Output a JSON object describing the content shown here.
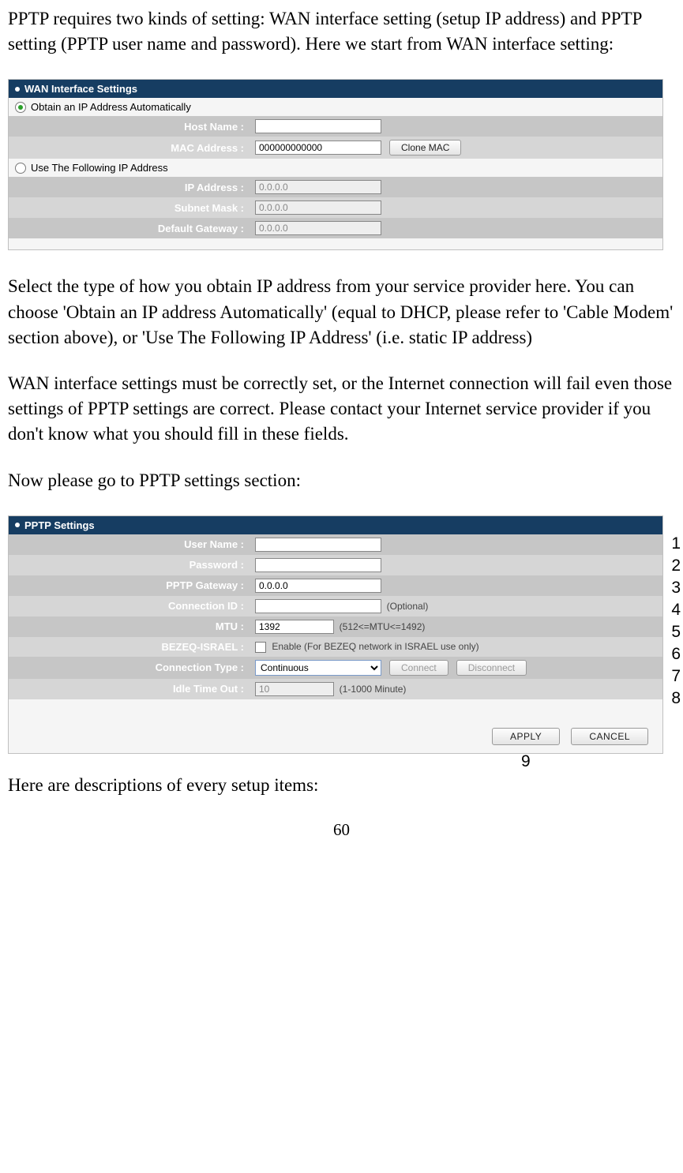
{
  "paragraphs": {
    "p1": "PPTP requires two kinds of setting: WAN interface setting (setup IP address) and PPTP setting (PPTP user name and password). Here we start from WAN interface setting:",
    "p2": "Select the type of how you obtain IP address from your service provider here. You can choose 'Obtain an IP address Automatically' (equal to DHCP, please refer to 'Cable Modem' section above), or 'Use The Following IP Address' (i.e. static IP address)",
    "p3": "WAN interface settings must be correctly set, or the Internet connection will fail even those settings of PPTP settings are correct. Please contact your Internet service provider if you don't know what you should fill in these fields.",
    "p4": "Now please go to PPTP settings section:",
    "p5": "Here are descriptions of every setup items:"
  },
  "page_number": "60",
  "wan": {
    "title": "WAN Interface Settings",
    "radio_auto": "Obtain an IP Address Automatically",
    "radio_static": "Use The Following IP Address",
    "host_name_label": "Host Name :",
    "host_name_value": "",
    "mac_label": "MAC Address :",
    "mac_value": "000000000000",
    "clone_mac": "Clone MAC",
    "ip_label": "IP Address :",
    "ip_value": "0.0.0.0",
    "subnet_label": "Subnet Mask :",
    "subnet_value": "0.0.0.0",
    "gateway_label": "Default Gateway :",
    "gateway_value": "0.0.0.0"
  },
  "pptp": {
    "title": "PPTP Settings",
    "user_label": "User Name :",
    "user_value": "",
    "pass_label": "Password :",
    "pass_value": "",
    "gw_label": "PPTP Gateway :",
    "gw_value": "0.0.0.0",
    "connid_label": "Connection ID :",
    "connid_value": "",
    "connid_note": "(Optional)",
    "mtu_label": "MTU :",
    "mtu_value": "1392",
    "mtu_note": "(512<=MTU<=1492)",
    "bezeq_label": "BEZEQ-ISRAEL :",
    "bezeq_note": "Enable (For BEZEQ network in ISRAEL use only)",
    "ctype_label": "Connection Type :",
    "ctype_value": "Continuous",
    "connect_btn": "Connect",
    "disconnect_btn": "Disconnect",
    "idle_label": "Idle Time Out :",
    "idle_value": "10",
    "idle_note": "(1-1000 Minute)",
    "apply": "APPLY",
    "cancel": "CANCEL"
  },
  "annotations": {
    "n1": "1",
    "n2": "2",
    "n3": "3",
    "n4": "4",
    "n5": "5",
    "n6": "6",
    "n7": "7",
    "n8": "8",
    "n9": "9"
  }
}
